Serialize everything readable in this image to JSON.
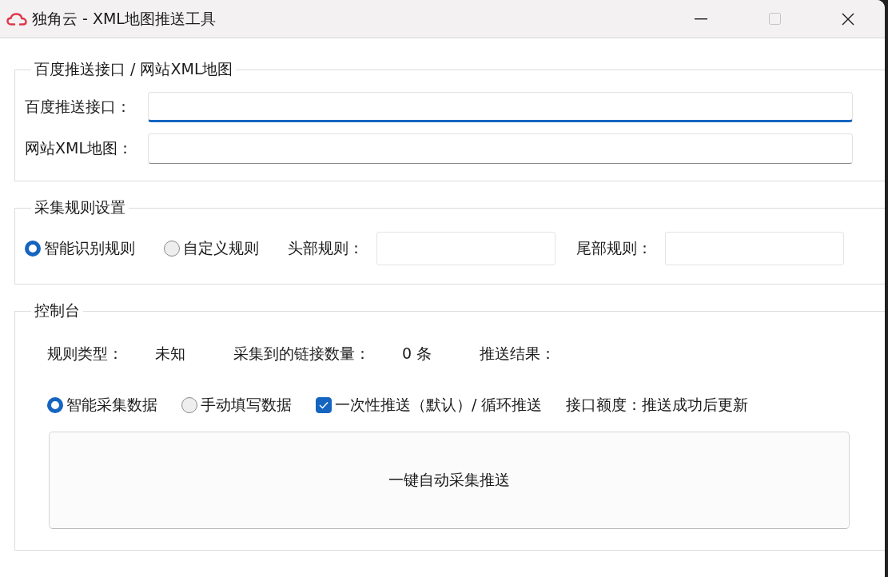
{
  "window": {
    "title": "独角云 - XML地图推送工具",
    "controls": [
      {
        "kind": "minimize",
        "disabled": false
      },
      {
        "kind": "maximize",
        "disabled": true
      },
      {
        "kind": "close",
        "disabled": false
      }
    ]
  },
  "push_group": {
    "title": "百度推送接口 / 网站XML地图",
    "fields": [
      {
        "label": "百度推送接口：",
        "focused": true
      },
      {
        "label": "网站XML地图：",
        "focused": false
      }
    ]
  },
  "rules_group": {
    "title": "采集规则设置",
    "modes": [
      {
        "label": "智能识别规则",
        "selected": true
      },
      {
        "label": "自定义规则",
        "selected": false
      }
    ],
    "fields": [
      {
        "label": "头部规则："
      },
      {
        "label": "尾部规则："
      }
    ]
  },
  "console_group": {
    "title": "控制台",
    "stats": [
      {
        "label": "规则类型：",
        "value": "未知"
      },
      {
        "label": "采集到的链接数量：",
        "value": "0 条"
      },
      {
        "label": "推送结果："
      }
    ],
    "sources": [
      {
        "label": "智能采集数据",
        "selected": true
      },
      {
        "label": "手动填写数据",
        "selected": false
      }
    ],
    "push_once": {
      "label": "一次性推送（默认）/ 循环推送",
      "checked": true
    },
    "quota": "接口额度：推送成功后更新",
    "action_button": "一键自动采集推送"
  }
}
